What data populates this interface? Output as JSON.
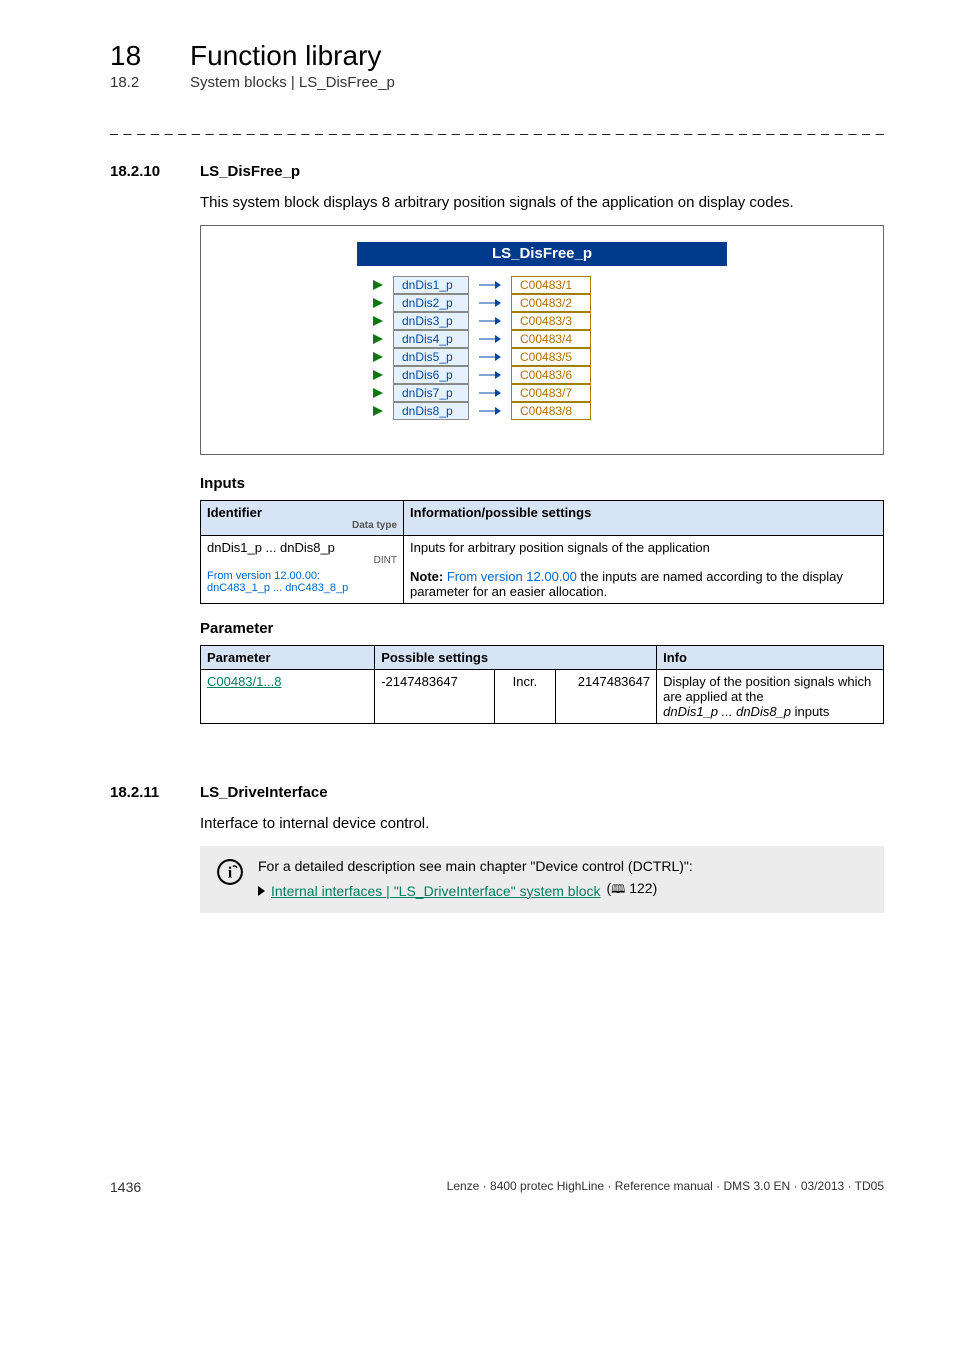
{
  "header": {
    "chapter_num": "18",
    "chapter_title": "Function library",
    "sub_num": "18.2",
    "sub_title": "System blocks | LS_DisFree_p",
    "dash_rule": "_ _ _ _ _ _ _ _ _ _ _ _ _ _ _ _ _ _ _ _ _ _ _ _ _ _ _ _ _ _ _ _ _ _ _ _ _ _ _ _ _ _ _ _ _ _ _ _ _ _ _ _ _ _ _ _ _ _ _ _ _ _ _ _"
  },
  "sect1": {
    "num": "18.2.10",
    "title": "LS_DisFree_p",
    "intro": "This system block displays 8 arbitrary position signals of the application on display codes."
  },
  "figure": {
    "title": "LS_DisFree_p",
    "rows": [
      {
        "port": "dnDis1_p",
        "code": "C00483/1"
      },
      {
        "port": "dnDis2_p",
        "code": "C00483/2"
      },
      {
        "port": "dnDis3_p",
        "code": "C00483/3"
      },
      {
        "port": "dnDis4_p",
        "code": "C00483/4"
      },
      {
        "port": "dnDis5_p",
        "code": "C00483/5"
      },
      {
        "port": "dnDis6_p",
        "code": "C00483/6"
      },
      {
        "port": "dnDis7_p",
        "code": "C00483/7"
      },
      {
        "port": "dnDis8_p",
        "code": "C00483/8"
      }
    ]
  },
  "inputs": {
    "heading": "Inputs",
    "th_identifier": "Identifier",
    "th_datatype": "Data type",
    "th_info": "Information/possible settings",
    "ident_main": "dnDis1_p ... dnDis8_p",
    "ident_dt": "DINT",
    "ident_ver_line1": "From version 12.00.00:",
    "ident_ver_line2": "dnC483_1_p ... dnC483_8_p",
    "info_line1": "Inputs for arbitrary position signals of the application",
    "info_note_label": "Note:",
    "info_note_blue": " From version 12.00.00 ",
    "info_note_rest1": "the inputs are named according to the display",
    "info_note_rest2": "parameter for an easier allocation."
  },
  "paramtbl": {
    "heading": "Parameter",
    "th_param": "Parameter",
    "th_poss": "Possible settings",
    "th_info": "Info",
    "code_link": "C00483/1...8",
    "lo": "-2147483647",
    "unit": "Incr.",
    "hi": "2147483647",
    "info_l1": "Display of the position signals which",
    "info_l2": "are applied at the",
    "info_l3": "dnDis1_p ... dnDis8_p",
    "info_l3_suffix": " inputs"
  },
  "sect2": {
    "num": "18.2.11",
    "title": "LS_DriveInterface",
    "intro": "Interface to internal device control."
  },
  "callout": {
    "line1": "For a detailed description see main chapter \"Device control (DCTRL)\":",
    "link_text": "Internal interfaces | \"LS_DriveInterface\" system block",
    "page_ref": "122"
  },
  "footer": {
    "page": "1436",
    "right": "Lenze · 8400 protec HighLine · Reference manual · DMS 3.0 EN · 03/2013 · TD05"
  }
}
